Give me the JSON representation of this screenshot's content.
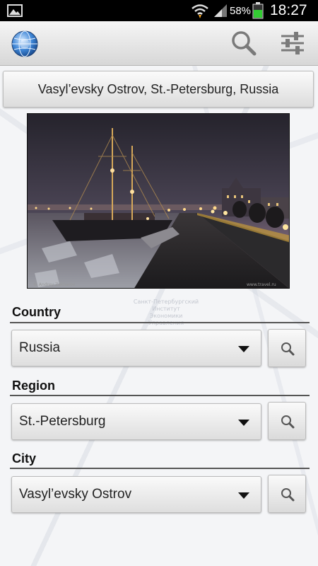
{
  "status_bar": {
    "battery_percent": "58%",
    "time": "18:27",
    "icons": [
      "gallery-icon",
      "wifi-icon",
      "signal-icon",
      "battery-icon"
    ],
    "battery_color": "#33cc33"
  },
  "action_bar": {
    "icons": [
      "app-logo-icon",
      "search-icon",
      "settings-sliders-icon"
    ]
  },
  "location_button": {
    "label": "Vasyl’evsky Ostrov, St.-Petersburg, Russia"
  },
  "map_labels": [
    "Санкт-Петербургский",
    "Институт",
    "Экономики",
    "Управления"
  ],
  "form": {
    "country": {
      "label": "Country",
      "value": "Russia"
    },
    "region": {
      "label": "Region",
      "value": "St.-Petersburg"
    },
    "city": {
      "label": "City",
      "value": "Vasyl’evsky Ostrov"
    }
  }
}
